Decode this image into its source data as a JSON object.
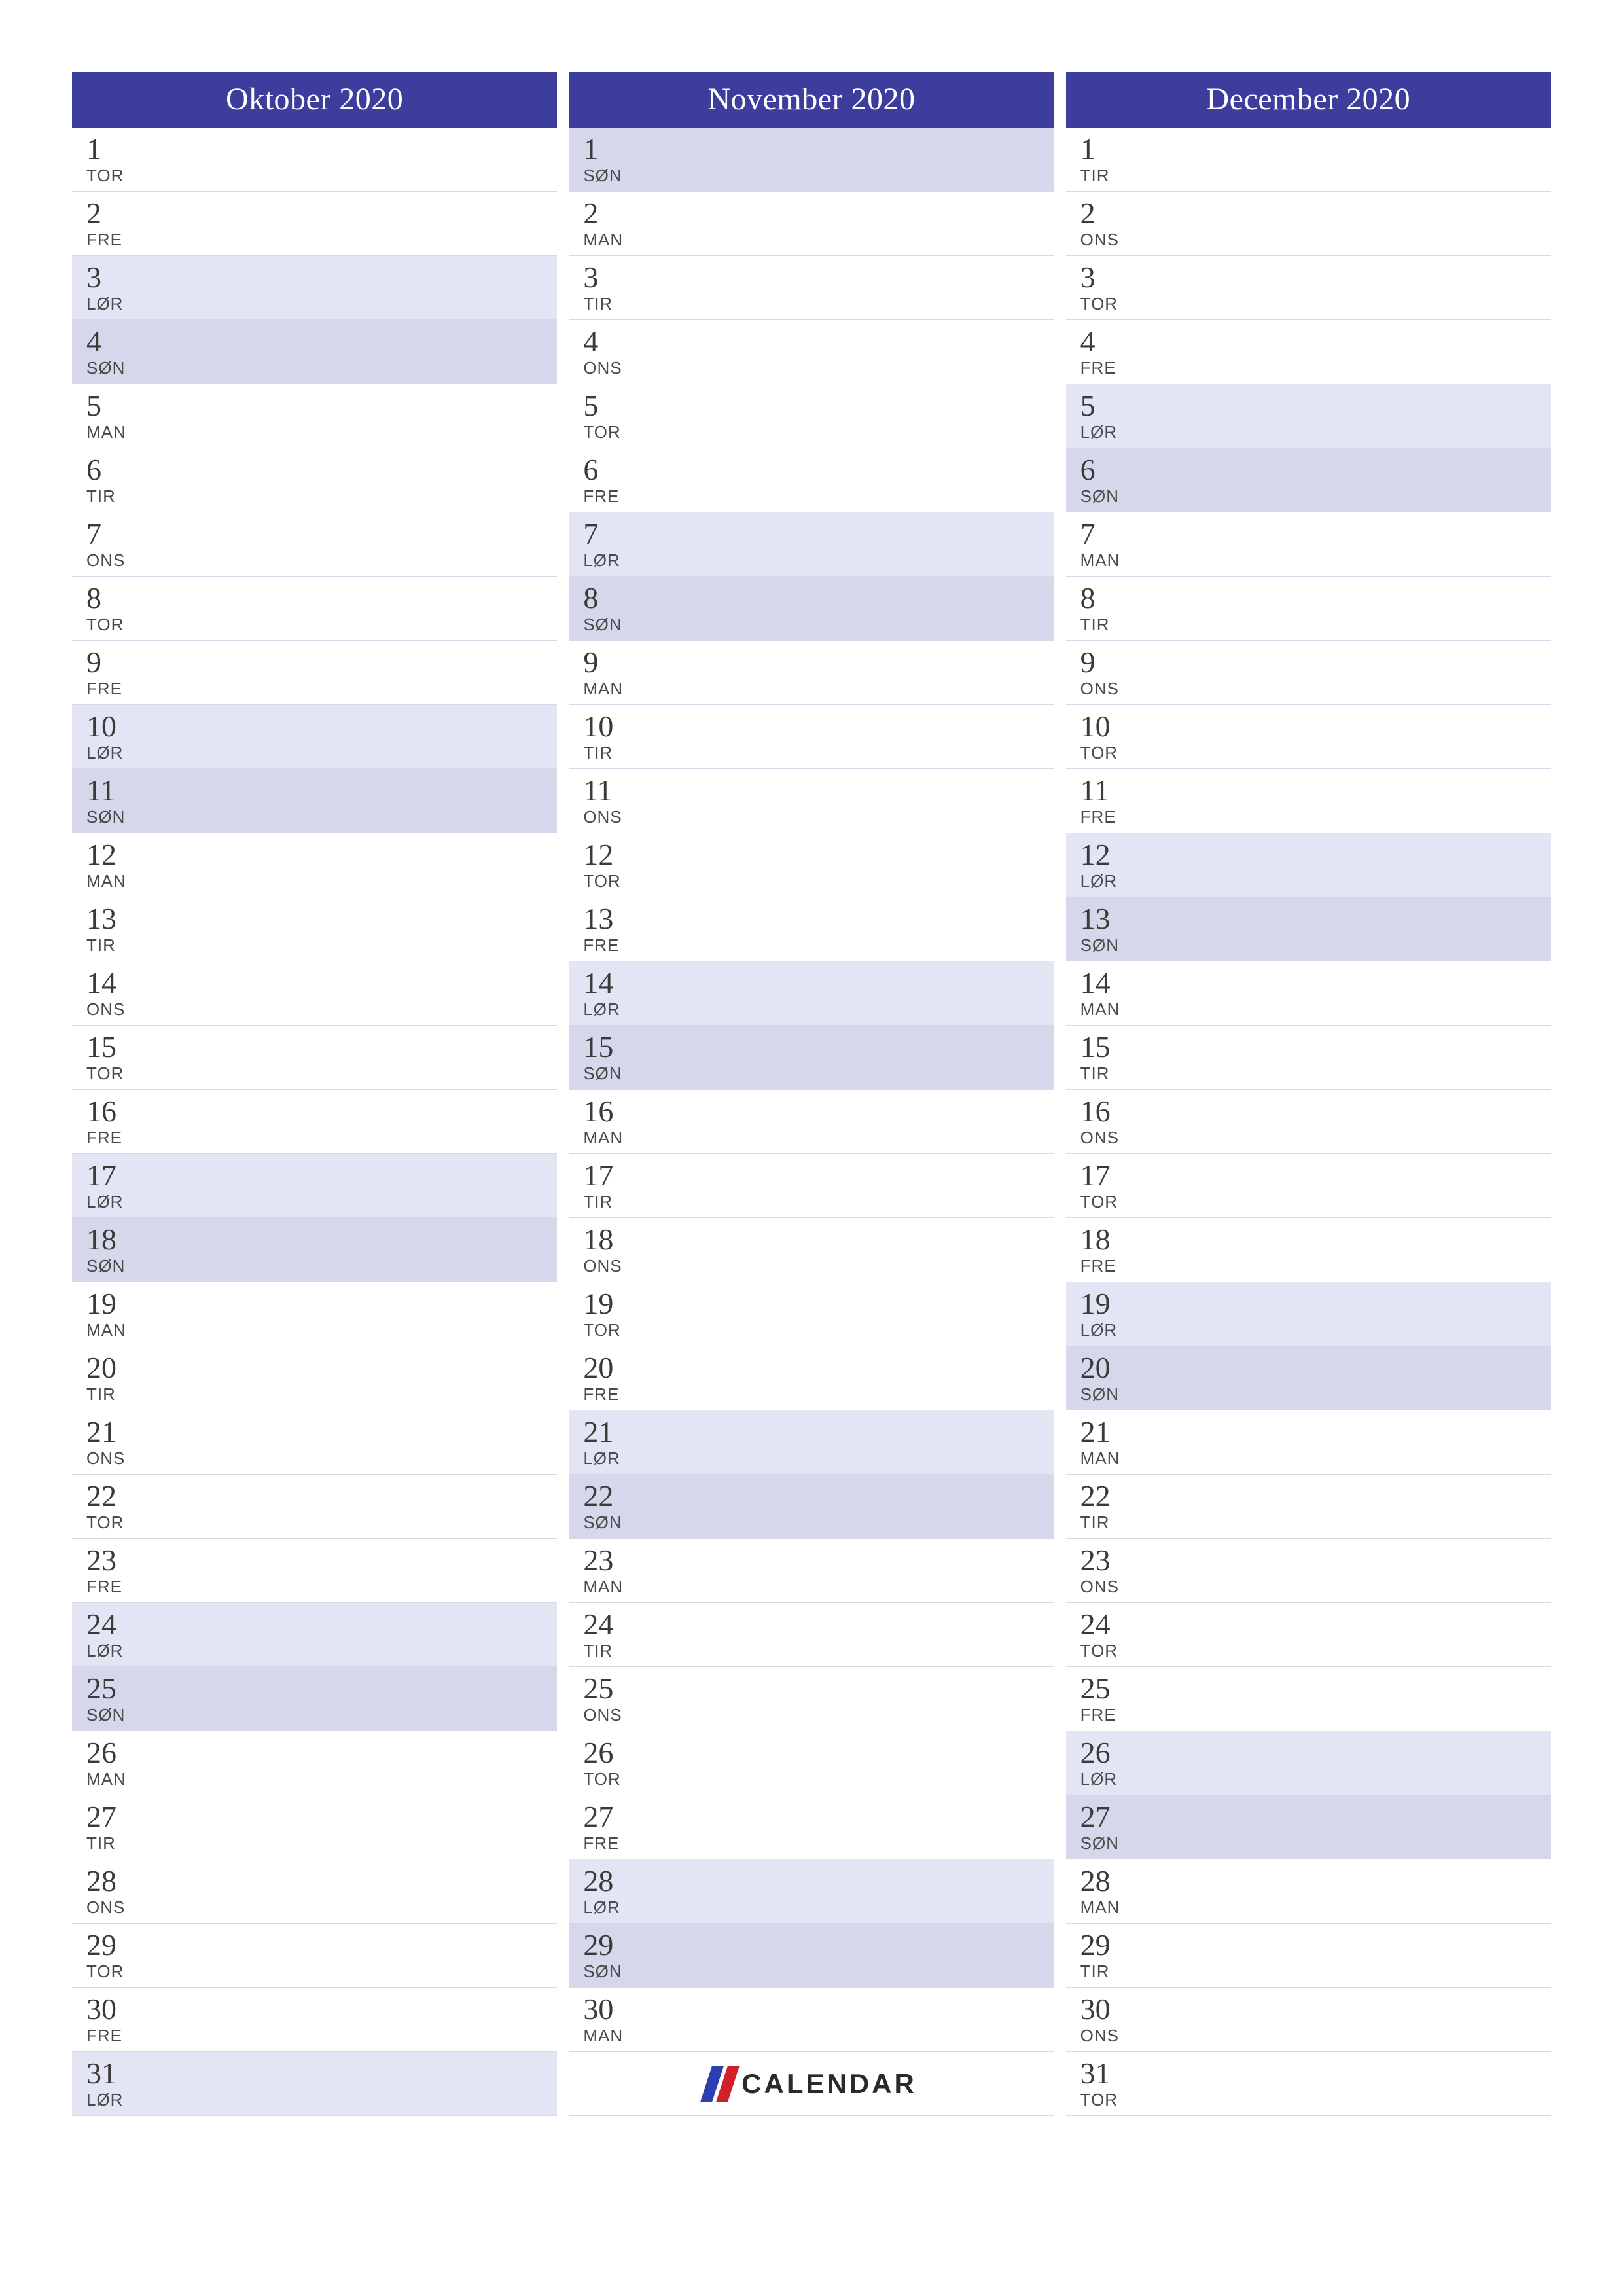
{
  "logo": {
    "text": "CALENDAR"
  },
  "day_abbr": {
    "mon": "MAN",
    "tue": "TIR",
    "wed": "ONS",
    "thu": "TOR",
    "fri": "FRE",
    "sat": "LØR",
    "sun": "SØN"
  },
  "months": [
    {
      "title": "Oktober 2020",
      "days": [
        {
          "n": 1,
          "w": "thu"
        },
        {
          "n": 2,
          "w": "fri"
        },
        {
          "n": 3,
          "w": "sat"
        },
        {
          "n": 4,
          "w": "sun"
        },
        {
          "n": 5,
          "w": "mon"
        },
        {
          "n": 6,
          "w": "tue"
        },
        {
          "n": 7,
          "w": "wed"
        },
        {
          "n": 8,
          "w": "thu"
        },
        {
          "n": 9,
          "w": "fri"
        },
        {
          "n": 10,
          "w": "sat"
        },
        {
          "n": 11,
          "w": "sun"
        },
        {
          "n": 12,
          "w": "mon"
        },
        {
          "n": 13,
          "w": "tue"
        },
        {
          "n": 14,
          "w": "wed"
        },
        {
          "n": 15,
          "w": "thu"
        },
        {
          "n": 16,
          "w": "fri"
        },
        {
          "n": 17,
          "w": "sat"
        },
        {
          "n": 18,
          "w": "sun"
        },
        {
          "n": 19,
          "w": "mon"
        },
        {
          "n": 20,
          "w": "tue"
        },
        {
          "n": 21,
          "w": "wed"
        },
        {
          "n": 22,
          "w": "thu"
        },
        {
          "n": 23,
          "w": "fri"
        },
        {
          "n": 24,
          "w": "sat"
        },
        {
          "n": 25,
          "w": "sun"
        },
        {
          "n": 26,
          "w": "mon"
        },
        {
          "n": 27,
          "w": "tue"
        },
        {
          "n": 28,
          "w": "wed"
        },
        {
          "n": 29,
          "w": "thu"
        },
        {
          "n": 30,
          "w": "fri"
        },
        {
          "n": 31,
          "w": "sat"
        }
      ]
    },
    {
      "title": "November 2020",
      "days": [
        {
          "n": 1,
          "w": "sun"
        },
        {
          "n": 2,
          "w": "mon"
        },
        {
          "n": 3,
          "w": "tue"
        },
        {
          "n": 4,
          "w": "wed"
        },
        {
          "n": 5,
          "w": "thu"
        },
        {
          "n": 6,
          "w": "fri"
        },
        {
          "n": 7,
          "w": "sat"
        },
        {
          "n": 8,
          "w": "sun"
        },
        {
          "n": 9,
          "w": "mon"
        },
        {
          "n": 10,
          "w": "tue"
        },
        {
          "n": 11,
          "w": "wed"
        },
        {
          "n": 12,
          "w": "thu"
        },
        {
          "n": 13,
          "w": "fri"
        },
        {
          "n": 14,
          "w": "sat"
        },
        {
          "n": 15,
          "w": "sun"
        },
        {
          "n": 16,
          "w": "mon"
        },
        {
          "n": 17,
          "w": "tue"
        },
        {
          "n": 18,
          "w": "wed"
        },
        {
          "n": 19,
          "w": "thu"
        },
        {
          "n": 20,
          "w": "fri"
        },
        {
          "n": 21,
          "w": "sat"
        },
        {
          "n": 22,
          "w": "sun"
        },
        {
          "n": 23,
          "w": "mon"
        },
        {
          "n": 24,
          "w": "tue"
        },
        {
          "n": 25,
          "w": "wed"
        },
        {
          "n": 26,
          "w": "thu"
        },
        {
          "n": 27,
          "w": "fri"
        },
        {
          "n": 28,
          "w": "sat"
        },
        {
          "n": 29,
          "w": "sun"
        },
        {
          "n": 30,
          "w": "mon"
        }
      ]
    },
    {
      "title": "December 2020",
      "days": [
        {
          "n": 1,
          "w": "tue"
        },
        {
          "n": 2,
          "w": "wed"
        },
        {
          "n": 3,
          "w": "thu"
        },
        {
          "n": 4,
          "w": "fri"
        },
        {
          "n": 5,
          "w": "sat"
        },
        {
          "n": 6,
          "w": "sun"
        },
        {
          "n": 7,
          "w": "mon"
        },
        {
          "n": 8,
          "w": "tue"
        },
        {
          "n": 9,
          "w": "wed"
        },
        {
          "n": 10,
          "w": "thu"
        },
        {
          "n": 11,
          "w": "fri"
        },
        {
          "n": 12,
          "w": "sat"
        },
        {
          "n": 13,
          "w": "sun"
        },
        {
          "n": 14,
          "w": "mon"
        },
        {
          "n": 15,
          "w": "tue"
        },
        {
          "n": 16,
          "w": "wed"
        },
        {
          "n": 17,
          "w": "thu"
        },
        {
          "n": 18,
          "w": "fri"
        },
        {
          "n": 19,
          "w": "sat"
        },
        {
          "n": 20,
          "w": "sun"
        },
        {
          "n": 21,
          "w": "mon"
        },
        {
          "n": 22,
          "w": "tue"
        },
        {
          "n": 23,
          "w": "wed"
        },
        {
          "n": 24,
          "w": "thu"
        },
        {
          "n": 25,
          "w": "fri"
        },
        {
          "n": 26,
          "w": "sat"
        },
        {
          "n": 27,
          "w": "sun"
        },
        {
          "n": 28,
          "w": "mon"
        },
        {
          "n": 29,
          "w": "tue"
        },
        {
          "n": 30,
          "w": "wed"
        },
        {
          "n": 31,
          "w": "thu"
        }
      ]
    }
  ]
}
